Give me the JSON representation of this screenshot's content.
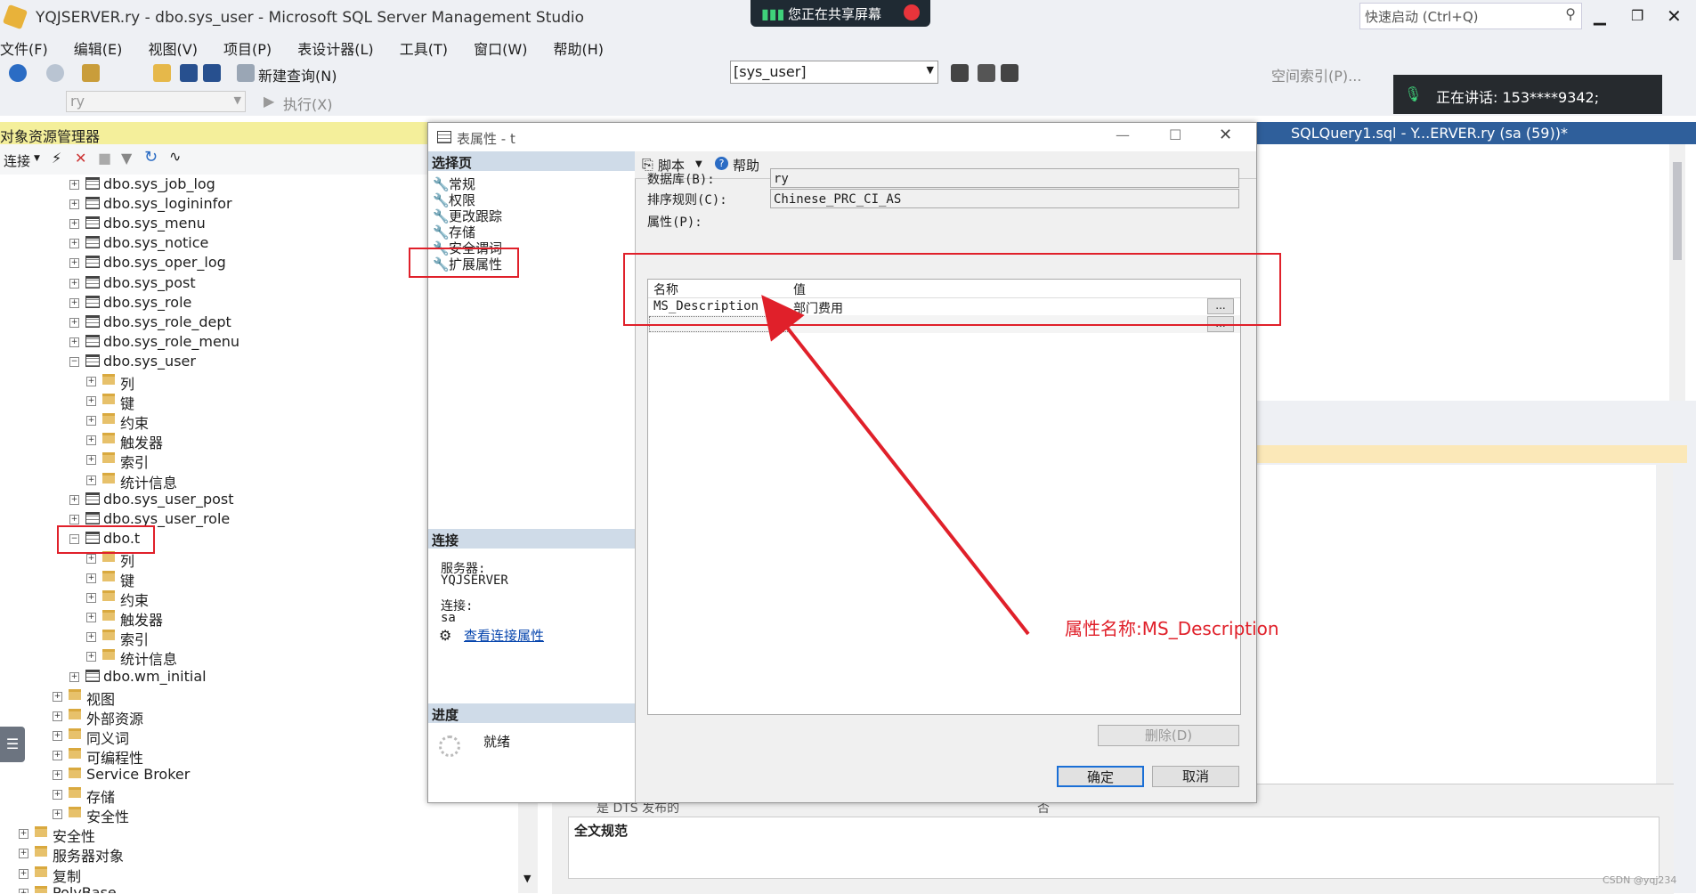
{
  "window": {
    "title": "YQJSERVER.ry - dbo.sys_user - Microsoft SQL Server Management Studio",
    "quick_launch": "快速启动 (Ctrl+Q)"
  },
  "share_banner": "您正在共享屏幕",
  "call_banner": "正在讲话:  153****9342;",
  "menu": [
    "文件(F)",
    "编辑(E)",
    "视图(V)",
    "项目(P)",
    "表设计器(L)",
    "工具(T)",
    "窗口(W)",
    "帮助(H)"
  ],
  "toolbar": {
    "new_query": "新建查询(N)",
    "object_combo": "[sys_user]",
    "spatial_index": "空间索引(P)...",
    "db_combo": "ry",
    "execute": "执行(X)"
  },
  "object_explorer": {
    "title": "对象资源管理器",
    "connect": "连接",
    "tree": [
      {
        "label": "dbo.sys_job_log",
        "icon": "table",
        "exp": "+"
      },
      {
        "label": "dbo.sys_logininfor",
        "icon": "table",
        "exp": "+"
      },
      {
        "label": "dbo.sys_menu",
        "icon": "table",
        "exp": "+"
      },
      {
        "label": "dbo.sys_notice",
        "icon": "table",
        "exp": "+"
      },
      {
        "label": "dbo.sys_oper_log",
        "icon": "table",
        "exp": "+"
      },
      {
        "label": "dbo.sys_post",
        "icon": "table",
        "exp": "+"
      },
      {
        "label": "dbo.sys_role",
        "icon": "table",
        "exp": "+"
      },
      {
        "label": "dbo.sys_role_dept",
        "icon": "table",
        "exp": "+"
      },
      {
        "label": "dbo.sys_role_menu",
        "icon": "table",
        "exp": "+"
      },
      {
        "label": "dbo.sys_user",
        "icon": "table",
        "exp": "-"
      },
      {
        "label": "列",
        "icon": "folder",
        "exp": "+"
      },
      {
        "label": "键",
        "icon": "folder",
        "exp": "+"
      },
      {
        "label": "约束",
        "icon": "folder",
        "exp": "+"
      },
      {
        "label": "触发器",
        "icon": "folder",
        "exp": "+"
      },
      {
        "label": "索引",
        "icon": "folder",
        "exp": "+"
      },
      {
        "label": "统计信息",
        "icon": "folder",
        "exp": "+"
      },
      {
        "label": "dbo.sys_user_post",
        "icon": "table",
        "exp": "+"
      },
      {
        "label": "dbo.sys_user_role",
        "icon": "table",
        "exp": "+"
      },
      {
        "label": "dbo.t",
        "icon": "table",
        "exp": "-"
      },
      {
        "label": "列",
        "icon": "folder",
        "exp": "+"
      },
      {
        "label": "键",
        "icon": "folder",
        "exp": "+"
      },
      {
        "label": "约束",
        "icon": "folder",
        "exp": "+"
      },
      {
        "label": "触发器",
        "icon": "folder",
        "exp": "+"
      },
      {
        "label": "索引",
        "icon": "folder",
        "exp": "+"
      },
      {
        "label": "统计信息",
        "icon": "folder",
        "exp": "+"
      },
      {
        "label": "dbo.wm_initial",
        "icon": "table",
        "exp": "+"
      },
      {
        "label": "视图",
        "icon": "folder",
        "exp": "+"
      },
      {
        "label": "外部资源",
        "icon": "folder",
        "exp": "+"
      },
      {
        "label": "同义词",
        "icon": "folder",
        "exp": "+"
      },
      {
        "label": "可编程性",
        "icon": "folder",
        "exp": "+"
      },
      {
        "label": "Service Broker",
        "icon": "folder",
        "exp": "+"
      },
      {
        "label": "存储",
        "icon": "folder",
        "exp": "+"
      },
      {
        "label": "安全性",
        "icon": "folder",
        "exp": "+"
      },
      {
        "label": "安全性",
        "icon": "folder",
        "exp": "+"
      },
      {
        "label": "服务器对象",
        "icon": "folder",
        "exp": "+"
      },
      {
        "label": "复制",
        "icon": "folder",
        "exp": "+"
      },
      {
        "label": "PolyBase",
        "icon": "folder",
        "exp": "+"
      }
    ]
  },
  "document_tab": "SQLQuery1.sql - Y...ERVER.ry (sa (59))*",
  "background": {
    "dts_label": "是 DTS 发布的",
    "dts_value": "否",
    "fulltext_label": "全文规范"
  },
  "dialog": {
    "title": "表属性 - t",
    "select_page_header": "选择页",
    "pages": [
      "常规",
      "权限",
      "更改跟踪",
      "存储",
      "安全谓词",
      "扩展属性"
    ],
    "script_button": "脚本",
    "help_button": "帮助",
    "database_label": "数据库(B):",
    "database_value": "ry",
    "collation_label": "排序规则(C):",
    "collation_value": "Chinese_PRC_CI_AS",
    "properties_label": "属性(P):",
    "grid_headers": [
      "名称",
      "值"
    ],
    "grid_rows": [
      {
        "name": "MS_Description",
        "value": "部门费用"
      }
    ],
    "ellipsis": "...",
    "connection_header": "连接",
    "server_label": "服务器:",
    "server_value": "YQJSERVER",
    "conn_label": "连接:",
    "conn_value": "sa",
    "view_conn_props": "查看连接属性",
    "progress_header": "进度",
    "progress_status": "就绪",
    "delete_button": "删除(D)",
    "ok_button": "确定",
    "cancel_button": "取消"
  },
  "annotation": "属性名称:MS_Description",
  "watermark": "CSDN @yqj234",
  "colors": {
    "annotation_red": "#e0202a",
    "explorer_header": "#f4ef9b",
    "tab_blue": "#2f5f9b"
  }
}
